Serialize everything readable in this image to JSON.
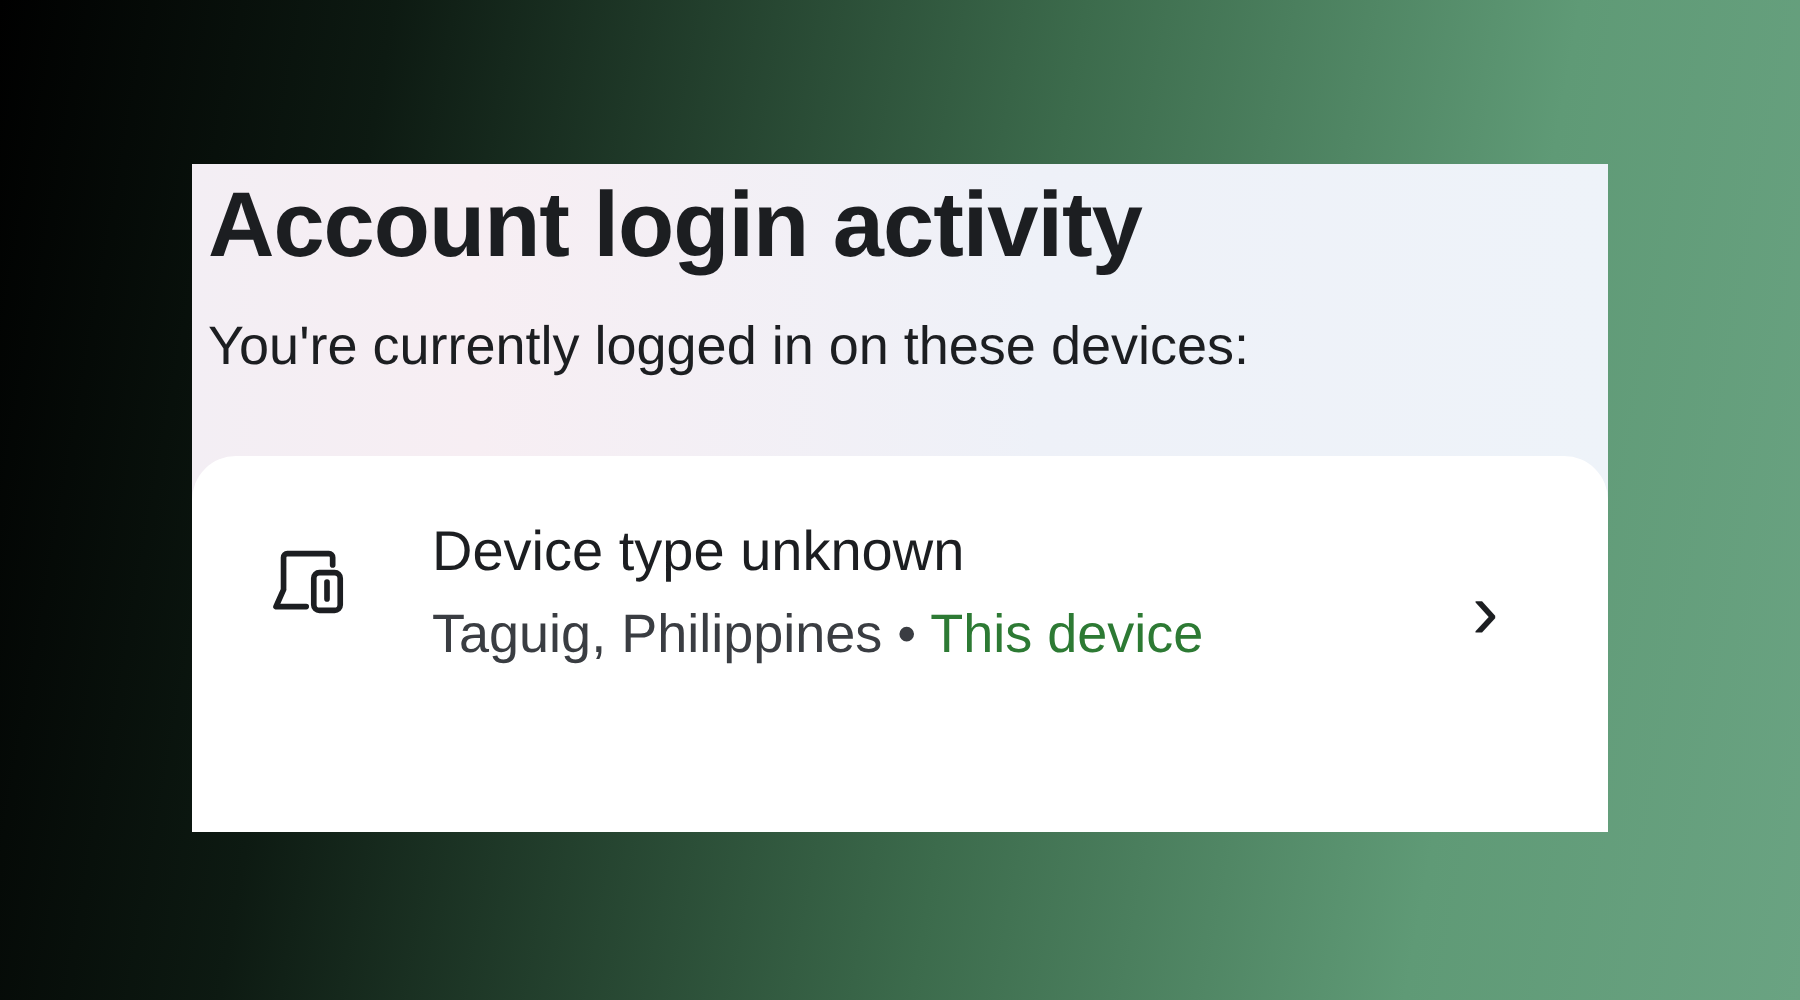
{
  "header": {
    "title": "Account login activity",
    "subtitle": "You're currently logged in on these devices:"
  },
  "devices": [
    {
      "kind": "unknown",
      "name": "Device type unknown",
      "location": "Taguig, Philippines",
      "separator": "•",
      "status": "This device",
      "current": true,
      "chevron": "›"
    }
  ]
}
